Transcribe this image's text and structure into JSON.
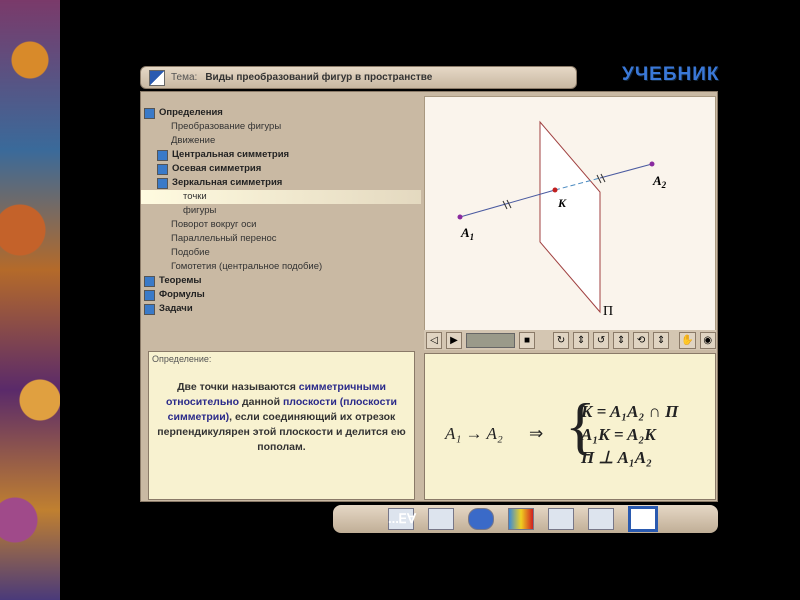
{
  "header": {
    "topic_label": "Тема:",
    "topic": "Виды преобразований фигур в пространстве",
    "logo": "УЧЕБНИК"
  },
  "tree": [
    {
      "label": "Определения",
      "level": 0,
      "bold": true,
      "icon": true
    },
    {
      "label": "Преобразование фигуры",
      "level": 1
    },
    {
      "label": "Движение",
      "level": 1
    },
    {
      "label": "Центральная симметрия",
      "level": 1,
      "bold": true,
      "icon": true
    },
    {
      "label": "Осевая симметрия",
      "level": 1,
      "bold": true,
      "icon": true
    },
    {
      "label": "Зеркальная симметрия",
      "level": 1,
      "bold": true,
      "icon": true
    },
    {
      "label": "точки",
      "level": 2,
      "selected": true
    },
    {
      "label": "фигуры",
      "level": 2
    },
    {
      "label": "Поворот вокруг оси",
      "level": 1
    },
    {
      "label": "Параллельный перенос",
      "level": 1
    },
    {
      "label": "Подобие",
      "level": 1
    },
    {
      "label": "Гомотетия (центральное подобие)",
      "level": 1
    },
    {
      "label": "Теоремы",
      "level": 0,
      "bold": true,
      "icon": true
    },
    {
      "label": "Формулы",
      "level": 0,
      "bold": true,
      "icon": true
    },
    {
      "label": "Задачи",
      "level": 0,
      "bold": true,
      "icon": true
    }
  ],
  "diagram": {
    "A1": "A",
    "A2": "A",
    "K": "K",
    "plane": "П",
    "sub1": "1",
    "sub2": "2"
  },
  "definition": {
    "label": "Определение:",
    "t1": "Две точки называются ",
    "h1": "симметричными относительно",
    "t2": " данной ",
    "h2": "плоскости (плоскости симметрии)",
    "t3": ", если соединяющий их отрезок перпендикулярен этой плоскости и делится ею пополам."
  },
  "formula": {
    "lhs": "A₁ → A₂",
    "implies": "⇒",
    "line1": "K = A₁A₂ ∩ П",
    "line2": "A₁K = A₂K",
    "line3": "П ⊥ A₁A₂"
  },
  "bottom": {
    "quantifiers": "∀∃..."
  },
  "colors": {
    "accent": "#3a78d8",
    "highlight": "#2a2a8a"
  }
}
